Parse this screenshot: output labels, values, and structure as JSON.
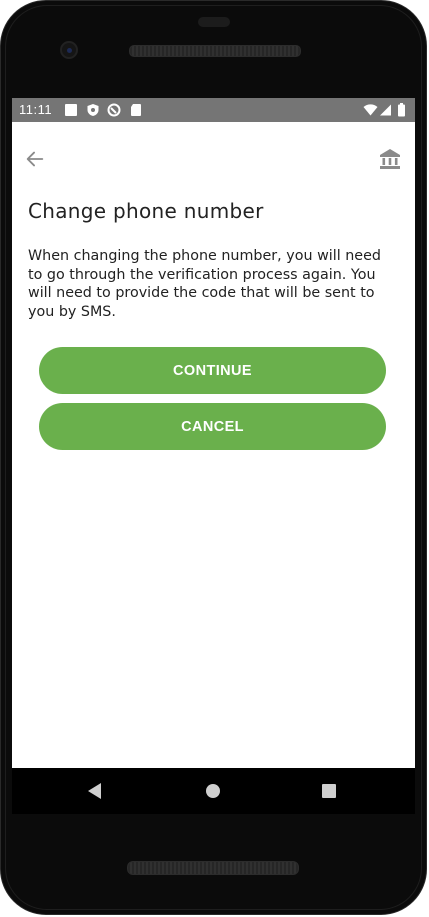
{
  "status_bar": {
    "time": "11:11",
    "icons": [
      "notification-square-icon",
      "shield-icon",
      "sync-icon",
      "sd-card-icon"
    ],
    "right_icons": [
      "wifi-icon",
      "signal-icon",
      "battery-icon"
    ]
  },
  "app_bar": {
    "back_icon": "arrow-left-icon",
    "action_icon": "bank-icon"
  },
  "content": {
    "title": "Change phone number",
    "description": "When changing the phone number, you will need to go through the verification process again. You will need to provide the code that will be sent to you by SMS."
  },
  "buttons": {
    "continue_label": "CONTINUE",
    "cancel_label": "CANCEL"
  },
  "colors": {
    "accent": "#6ab04c",
    "status_bar": "#757575",
    "text": "#222222",
    "icon_gray": "#8a8a8a"
  }
}
